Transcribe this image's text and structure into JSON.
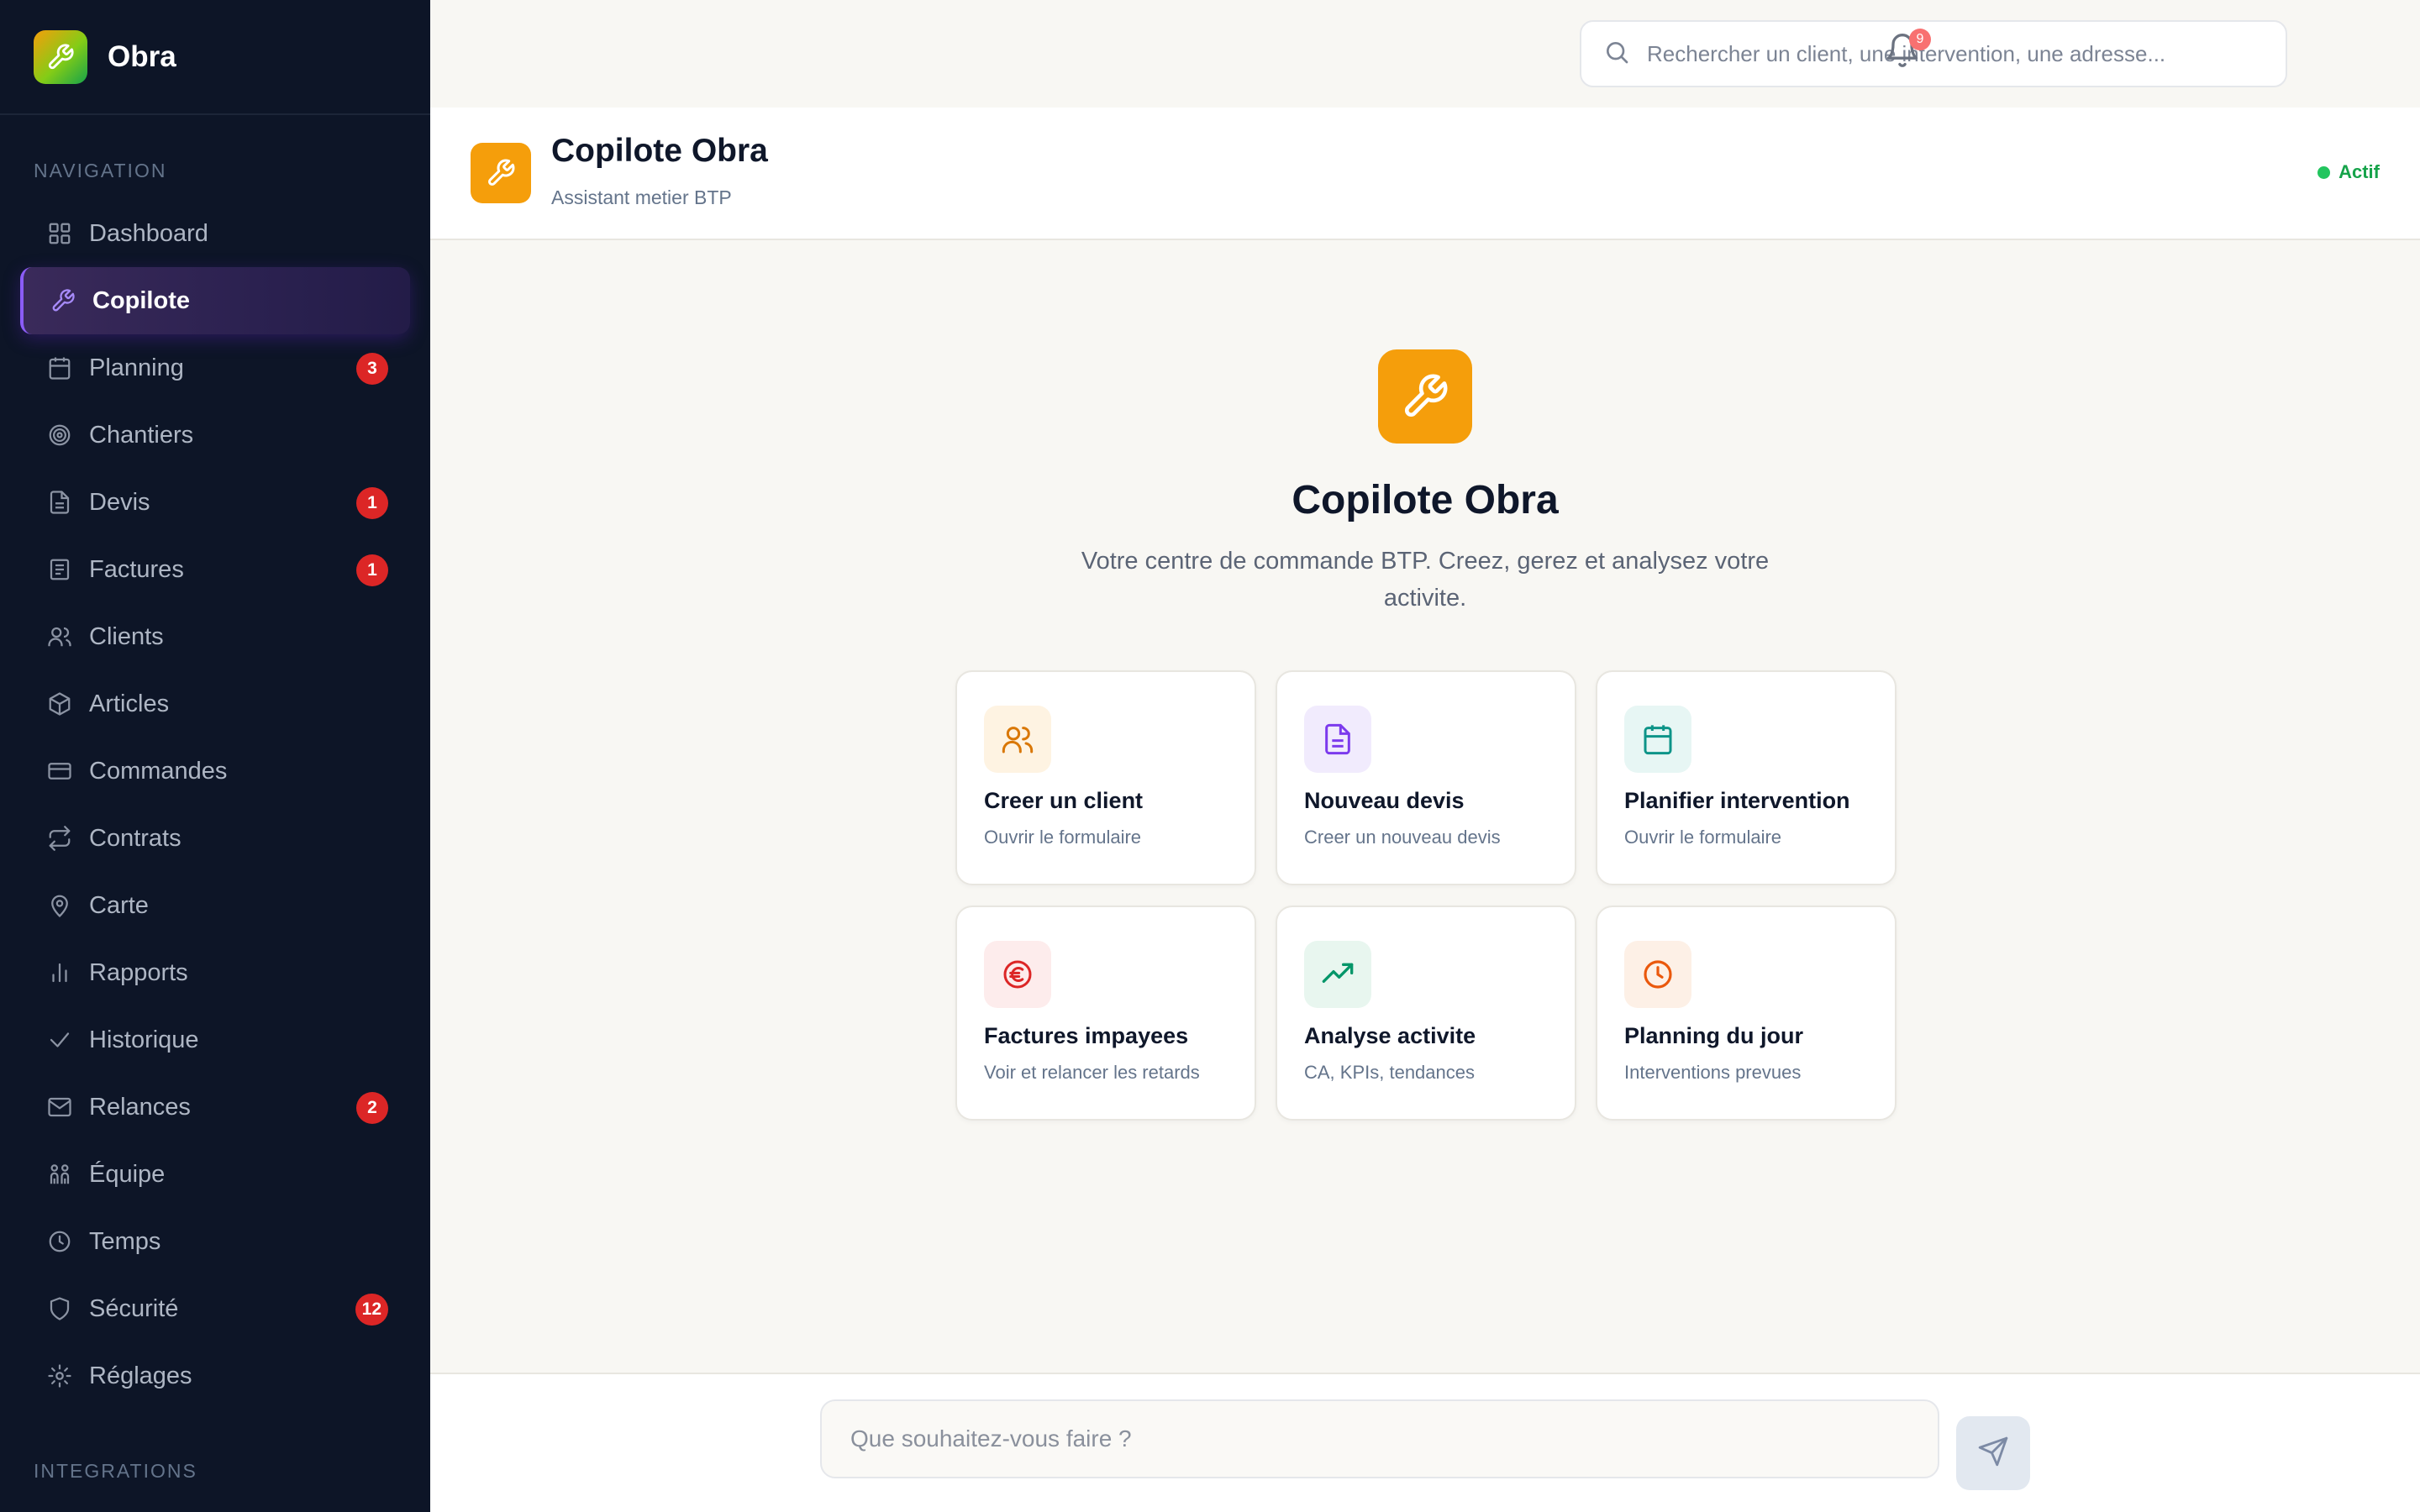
{
  "brand": {
    "name": "Obra"
  },
  "sidebar": {
    "nav_section_label": "NAVIGATION",
    "integrations_section_label": "INTEGRATIONS",
    "items": [
      {
        "label": "Dashboard",
        "icon": "grid-icon"
      },
      {
        "label": "Copilote",
        "icon": "wrench-icon",
        "active": true
      },
      {
        "label": "Planning",
        "icon": "calendar-icon",
        "badge": "3"
      },
      {
        "label": "Chantiers",
        "icon": "target-icon"
      },
      {
        "label": "Devis",
        "icon": "document-icon",
        "badge": "1"
      },
      {
        "label": "Factures",
        "icon": "invoice-icon",
        "badge": "1"
      },
      {
        "label": "Clients",
        "icon": "users-icon"
      },
      {
        "label": "Articles",
        "icon": "box-icon"
      },
      {
        "label": "Commandes",
        "icon": "credit-card-icon"
      },
      {
        "label": "Contrats",
        "icon": "repeat-icon"
      },
      {
        "label": "Carte",
        "icon": "map-pin-icon"
      },
      {
        "label": "Rapports",
        "icon": "bar-chart-icon"
      },
      {
        "label": "Historique",
        "icon": "check-icon"
      },
      {
        "label": "Relances",
        "icon": "mail-icon",
        "badge": "2"
      },
      {
        "label": "Équipe",
        "icon": "team-icon"
      },
      {
        "label": "Temps",
        "icon": "clock-icon"
      },
      {
        "label": "Sécurité",
        "icon": "shield-icon",
        "badge": "12"
      },
      {
        "label": "Réglages",
        "icon": "settings-icon"
      }
    ]
  },
  "topbar": {
    "search_placeholder": "Rechercher un client, une intervention, une adresse...",
    "notification_count": "9"
  },
  "header": {
    "title": "Copilote Obra",
    "subtitle": "Assistant metier BTP",
    "status": "Actif"
  },
  "hero": {
    "title": "Copilote Obra",
    "subtitle": "Votre centre de commande BTP. Creez, gerez et analysez votre activite."
  },
  "cards": [
    {
      "title": "Creer un client",
      "subtitle": "Ouvrir le formulaire",
      "icon": "users-icon",
      "color": "#d97706",
      "bg": "#fef3e2"
    },
    {
      "title": "Nouveau devis",
      "subtitle": "Creer un nouveau devis",
      "icon": "document-icon",
      "color": "#7c3aed",
      "bg": "#f1ebfd"
    },
    {
      "title": "Planifier intervention",
      "subtitle": "Ouvrir le formulaire",
      "icon": "calendar-icon",
      "color": "#0d9488",
      "bg": "#e7f6f4"
    },
    {
      "title": "Factures impayees",
      "subtitle": "Voir et relancer les retards",
      "icon": "euro-icon",
      "color": "#dc2626",
      "bg": "#fdecec"
    },
    {
      "title": "Analyse activite",
      "subtitle": "CA, KPIs, tendances",
      "icon": "trending-up-icon",
      "color": "#059669",
      "bg": "#e8f6ef"
    },
    {
      "title": "Planning du jour",
      "subtitle": "Interventions prevues",
      "icon": "clock-icon",
      "color": "#ea580c",
      "bg": "#fdf0e6"
    }
  ],
  "composer": {
    "placeholder": "Que souhaitez-vous faire ?"
  },
  "colors": {
    "sidebar_bg": "#0d1527",
    "accent_amber": "#f59e0b",
    "accent_violet": "#8b5cf6",
    "badge_red": "#dc2626",
    "status_green": "#16a34a"
  }
}
